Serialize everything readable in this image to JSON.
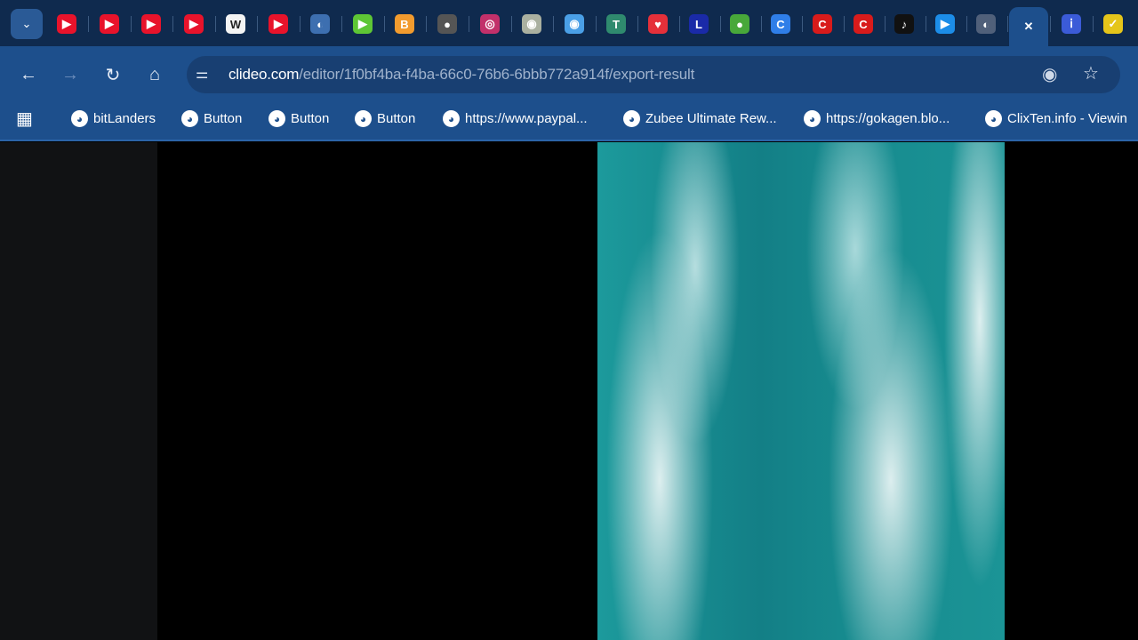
{
  "tabs": [
    {
      "icon": "youtube-icon",
      "color": "#e8132b",
      "glyph": "▶"
    },
    {
      "icon": "youtube-icon",
      "color": "#e8132b",
      "glyph": "▶"
    },
    {
      "icon": "youtube-icon",
      "color": "#e8132b",
      "glyph": "▶"
    },
    {
      "icon": "youtube-icon",
      "color": "#e8132b",
      "glyph": "▶"
    },
    {
      "icon": "wikipedia-icon",
      "color": "#f4f4f4",
      "glyph": "W"
    },
    {
      "icon": "youtube-icon",
      "color": "#e8132b",
      "glyph": "▶"
    },
    {
      "icon": "globe-site-icon",
      "color": "#3d6fb0",
      "glyph": "◐"
    },
    {
      "icon": "rumble-icon",
      "color": "#5ec635",
      "glyph": "▶"
    },
    {
      "icon": "blogger-icon",
      "color": "#f29b2e",
      "glyph": "B"
    },
    {
      "icon": "site-icon",
      "color": "#555",
      "glyph": "●"
    },
    {
      "icon": "site-icon",
      "color": "#c2306a",
      "glyph": "◎"
    },
    {
      "icon": "site-icon",
      "color": "#aab0a0",
      "glyph": "◉"
    },
    {
      "icon": "site-icon",
      "color": "#4a9fe6",
      "glyph": "◉"
    },
    {
      "icon": "site-icon",
      "color": "#2f8a6e",
      "glyph": "T"
    },
    {
      "icon": "site-icon",
      "color": "#e5303a",
      "glyph": "♥"
    },
    {
      "icon": "site-icon",
      "color": "#1a2aa8",
      "glyph": "L"
    },
    {
      "icon": "site-icon",
      "color": "#48a83a",
      "glyph": "●"
    },
    {
      "icon": "site-icon",
      "color": "#2f7ee8",
      "glyph": "C"
    },
    {
      "icon": "site-icon",
      "color": "#d81b1b",
      "glyph": "C"
    },
    {
      "icon": "site-icon",
      "color": "#d81b1b",
      "glyph": "C"
    },
    {
      "icon": "tiktok-icon",
      "color": "#111",
      "glyph": "♪"
    },
    {
      "icon": "site-icon",
      "color": "#1c8de8",
      "glyph": "▶"
    },
    {
      "icon": "site-icon",
      "color": "#50607a",
      "glyph": "◐"
    },
    {
      "icon": "close-icon",
      "color": "transparent",
      "glyph": "✕"
    },
    {
      "icon": "site-icon",
      "color": "#3b5bd8",
      "glyph": "ⅰ"
    },
    {
      "icon": "site-icon",
      "color": "#e5c51a",
      "glyph": "✓"
    }
  ],
  "tab_search_glyph": "⌄",
  "address": {
    "domain": "clideo.com",
    "path": "/editor/1f0bf4ba-f4ba-66c0-76b6-6bbb772a914f/export-result"
  },
  "bookmarks": [
    "bitLanders",
    "Button",
    "Button",
    "Button",
    "https://www.paypal...",
    "Zubee Ultimate Rew...",
    "https://gokagen.blo...",
    "ClixTen.info - Viewin"
  ]
}
